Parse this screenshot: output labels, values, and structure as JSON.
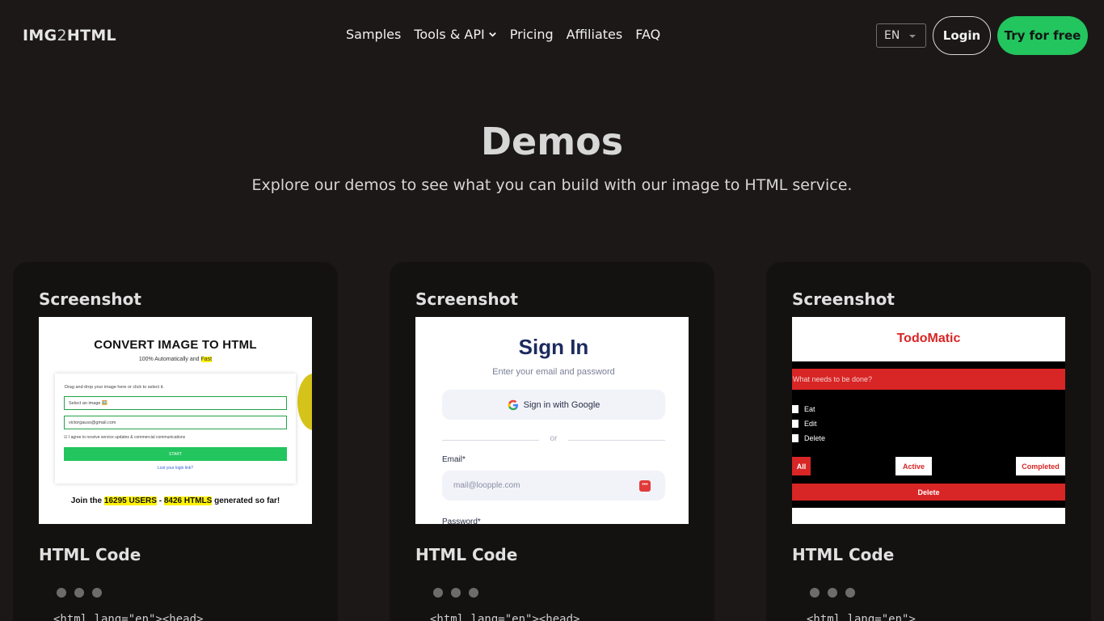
{
  "nav": {
    "logo_left": "IMG",
    "logo_mid": "2",
    "logo_right": "HTML",
    "links": [
      "Samples",
      "Tools & API",
      "Pricing",
      "Affiliates",
      "FAQ"
    ],
    "language": "EN",
    "login": "Login",
    "cta": "Try for free"
  },
  "hero": {
    "title": "Demos",
    "subtitle": "Explore our demos to see what you can build with our image to HTML service."
  },
  "cards": [
    {
      "screenshot_label": "Screenshot",
      "code_label": "HTML Code",
      "code_line": "<html lang=\"en\"><head>",
      "preview": {
        "title": "CONVERT IMAGE TO HTML",
        "sub_prefix": "100% Automatically and",
        "sub_highlight": "Fast",
        "drop_text": "Drag and drop your image here or click to select it.",
        "select_field": "Select an image 🖼️",
        "email_field": "victorgauss@gmail.com",
        "checkbox_text": "I agree to receive service updates & commercial communications",
        "start": "START",
        "login_link": "Lost your login link?",
        "join_prefix": "Join the",
        "users": "16295 USERS",
        "dash": "-",
        "htmls": "8426 HTMLS",
        "join_suffix": "generated so far!"
      }
    },
    {
      "screenshot_label": "Screenshot",
      "code_label": "HTML Code",
      "code_line": "<html lang=\"en\"><head>",
      "preview": {
        "title": "Sign In",
        "subtitle": "Enter your email and password",
        "google": "Sign in with Google",
        "or": "or",
        "email_label": "Email*",
        "email_placeholder": "mail@loopple.com",
        "password_label": "Password*"
      }
    },
    {
      "screenshot_label": "Screenshot",
      "code_label": "HTML Code",
      "code_line": "<html lang=\"en\">",
      "preview": {
        "title": "TodoMatic",
        "input_placeholder": "What needs to be done?",
        "tasks": [
          "Eat",
          "Edit",
          "Delete"
        ],
        "filters": [
          "All",
          "Active",
          "Completed"
        ],
        "delete": "Delete"
      }
    }
  ],
  "colors": {
    "background": "#1c1817",
    "card": "#141111",
    "accent_green": "#22c55e",
    "todo_red": "#d82525",
    "signin_navy": "#1c2a5e"
  }
}
